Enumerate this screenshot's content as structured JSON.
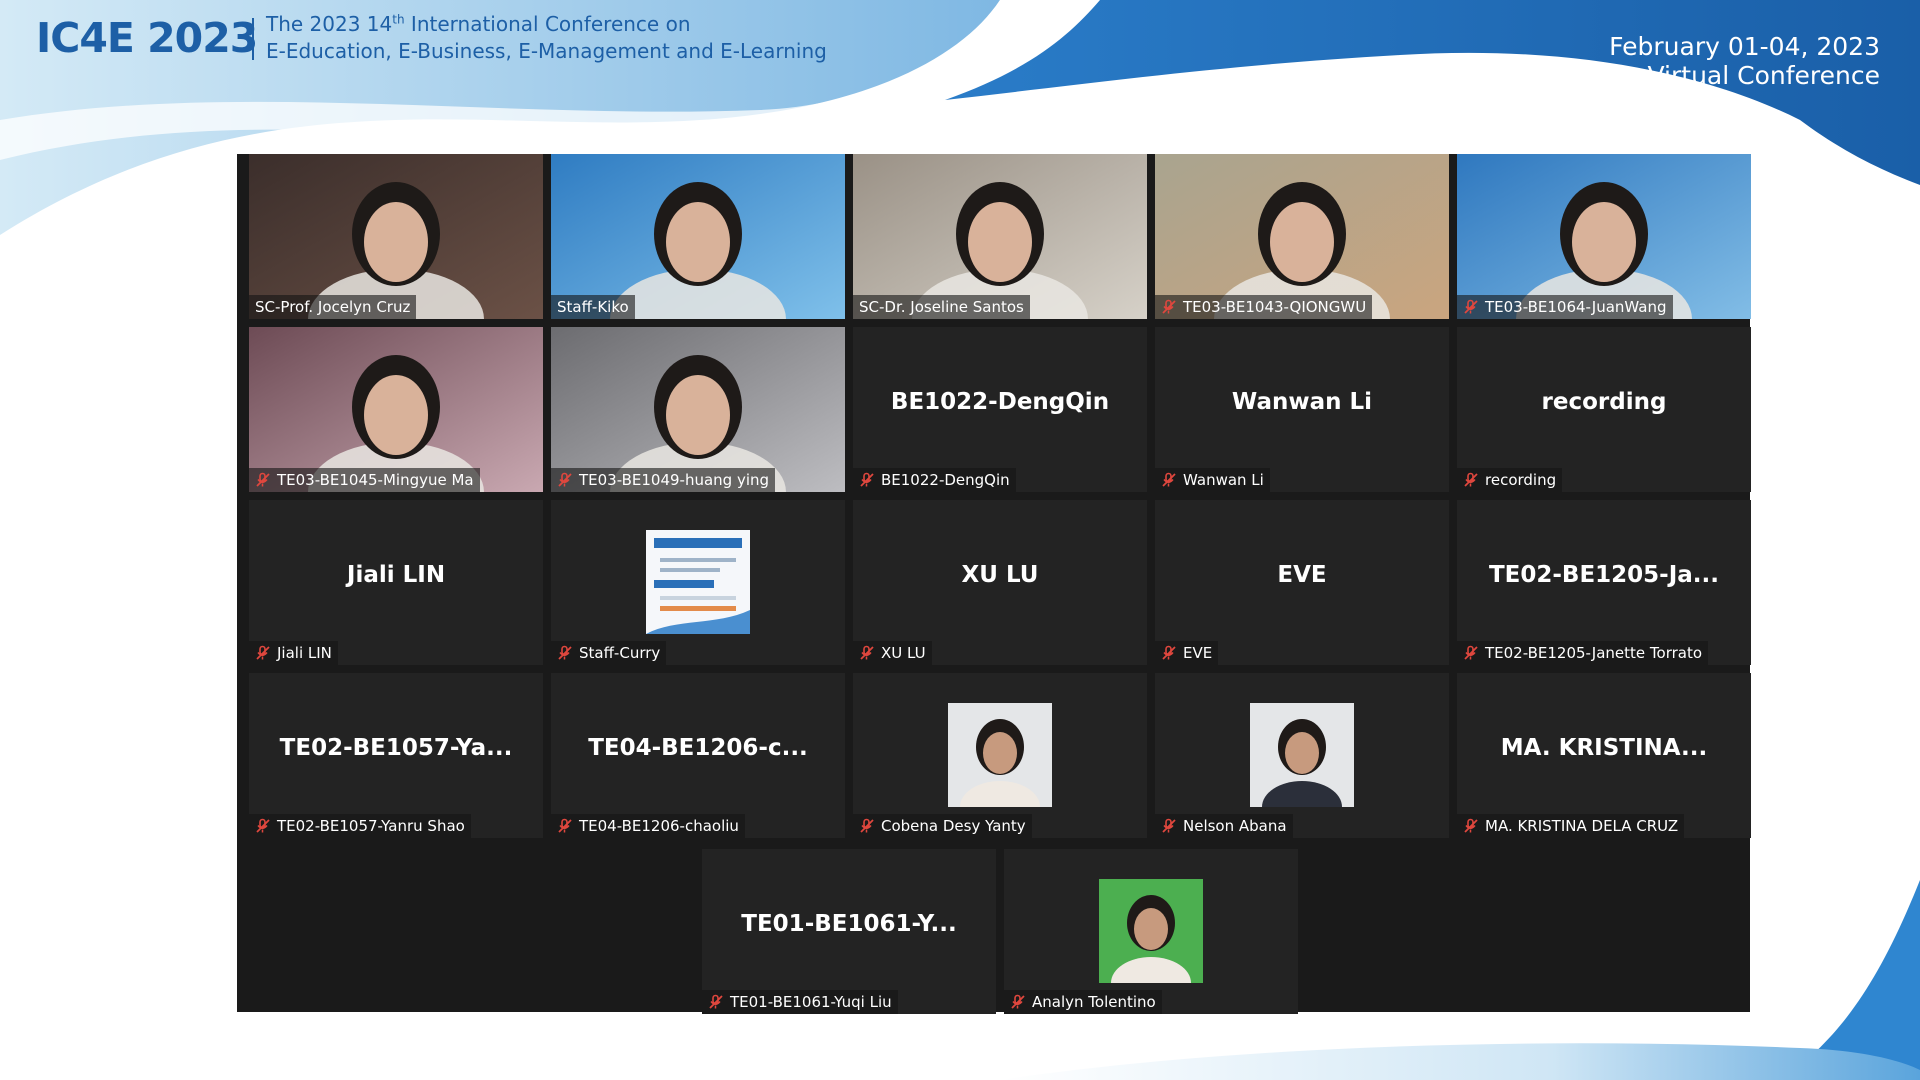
{
  "header": {
    "brand": "IC4E 2023",
    "conference_line1_prefix": "The 2023 14",
    "conference_line1_sup": "th",
    "conference_line1_suffix": " International Conference on",
    "conference_line2": "E-Education, E-Business, E-Management and E-Learning",
    "dates": "February 01-04, 2023",
    "mode": "Virtual Conference"
  },
  "colors": {
    "brand_blue": "#1d5fa6",
    "grid_bg": "#1a1a1a",
    "tile_bg": "#232323",
    "active_speaker_border": "#e3e36a",
    "mic_muted": "#e0473e"
  },
  "participants": [
    {
      "label": "SC-Prof. Jocelyn Cruz",
      "display": "",
      "media": "video",
      "muted": false
    },
    {
      "label": "Staff-Kiko",
      "display": "",
      "media": "video",
      "muted": false,
      "active": true
    },
    {
      "label": "SC-Dr. Joseline Santos",
      "display": "",
      "media": "video",
      "muted": false
    },
    {
      "label": "TE03-BE1043-QIONGWU",
      "display": "",
      "media": "video",
      "muted": true
    },
    {
      "label": "TE03-BE1064-JuanWang",
      "display": "",
      "media": "video",
      "muted": true
    },
    {
      "label": "TE03-BE1045-Mingyue Ma",
      "display": "",
      "media": "video",
      "muted": true
    },
    {
      "label": "TE03-BE1049-huang ying",
      "display": "",
      "media": "video",
      "muted": true
    },
    {
      "label": "BE1022-DengQin",
      "display": "BE1022-DengQin",
      "media": "none",
      "muted": true
    },
    {
      "label": "Wanwan Li",
      "display": "Wanwan Li",
      "media": "none",
      "muted": true
    },
    {
      "label": "recording",
      "display": "recording",
      "media": "none",
      "muted": true
    },
    {
      "label": "Jiali LIN",
      "display": "Jiali LIN",
      "media": "none",
      "muted": true
    },
    {
      "label": "Staff-Curry",
      "display": "",
      "media": "avatar",
      "muted": true
    },
    {
      "label": "XU LU",
      "display": "XU LU",
      "media": "none",
      "muted": true
    },
    {
      "label": "EVE",
      "display": "EVE",
      "media": "none",
      "muted": true
    },
    {
      "label": "TE02-BE1205-Janette Torrato",
      "display": "TE02-BE1205-Ja...",
      "media": "none",
      "muted": true
    },
    {
      "label": "TE02-BE1057-Yanru Shao",
      "display": "TE02-BE1057-Ya...",
      "media": "none",
      "muted": true
    },
    {
      "label": "TE04-BE1206-chaoliu",
      "display": "TE04-BE1206-c...",
      "media": "none",
      "muted": true
    },
    {
      "label": "Cobena Desy Yanty",
      "display": "",
      "media": "avatar",
      "muted": true
    },
    {
      "label": "Nelson Abana",
      "display": "",
      "media": "avatar",
      "muted": true
    },
    {
      "label": "MA. KRISTINA DELA CRUZ",
      "display": "MA.  KRISTINA...",
      "media": "none",
      "muted": true
    },
    {
      "label": "TE01-BE1061-Yuqi Liu",
      "display": "TE01-BE1061-Y...",
      "media": "none",
      "muted": true
    },
    {
      "label": "Analyn Tolentino",
      "display": "",
      "media": "avatar",
      "muted": true
    }
  ]
}
